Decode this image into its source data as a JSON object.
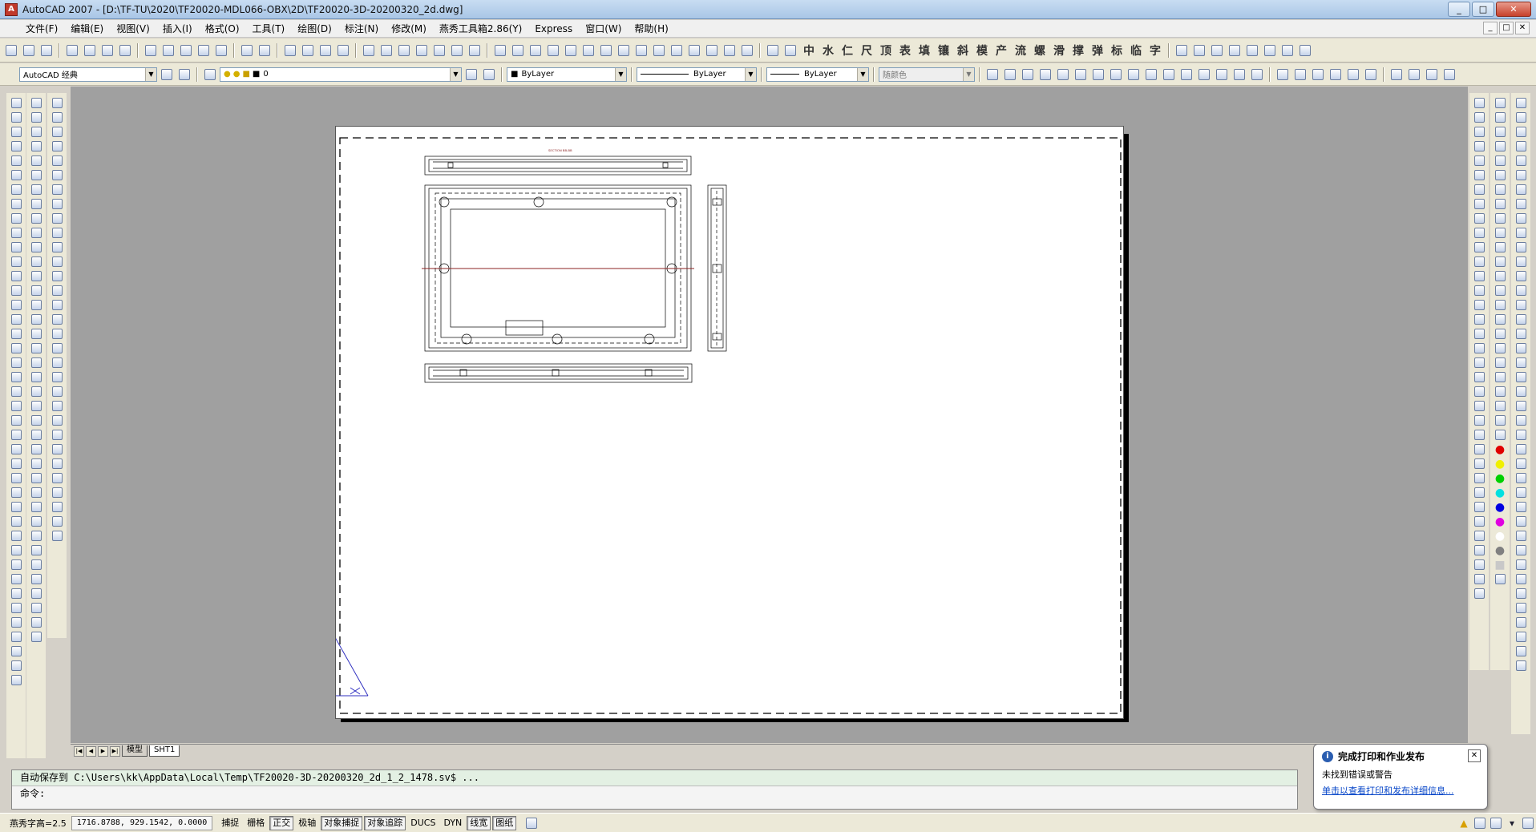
{
  "window": {
    "title": "AutoCAD 2007 - [D:\\TF-TU\\2020\\TF20020-MDL066-OBX\\2D\\TF20020-3D-20200320_2d.dwg]",
    "controls": [
      "_",
      "□",
      "✕"
    ]
  },
  "menu": [
    "文件(F)",
    "编辑(E)",
    "视图(V)",
    "插入(I)",
    "格式(O)",
    "工具(T)",
    "绘图(D)",
    "标注(N)",
    "修改(M)",
    "燕秀工具箱2.86(Y)",
    "Express",
    "窗口(W)",
    "帮助(H)"
  ],
  "toolbar_row1": {
    "cjk_tools": [
      "中",
      "水",
      "仁",
      "尺",
      "顶",
      "表",
      "填",
      "镶",
      "斜",
      "模",
      "产",
      "流",
      "螺",
      "滑",
      "撑",
      "弹",
      "标",
      "临",
      "字"
    ]
  },
  "toolbar_row2": {
    "workspace": "AutoCAD 经典",
    "layer": "0",
    "color": "ByLayer",
    "linetype": "ByLayer",
    "lineweight": "ByLayer",
    "plotstyle": "随颜色"
  },
  "drawing": {
    "section_label": "SECTION BB-BB"
  },
  "layout_tabs": {
    "model": "模型",
    "sheet": "SHT1"
  },
  "command": {
    "history": "自动保存到 C:\\Users\\kk\\AppData\\Local\\Temp\\TF20020-3D-20200320_2d_1_2_1478.sv$ ...",
    "prompt": "命令:"
  },
  "status": {
    "text_height": "燕秀字高=2.5",
    "coords": "1716.8788, 929.1542, 0.0000",
    "toggles": [
      {
        "label": "捕捉",
        "on": false
      },
      {
        "label": "栅格",
        "on": false
      },
      {
        "label": "正交",
        "on": true
      },
      {
        "label": "极轴",
        "on": false
      },
      {
        "label": "对象捕捉",
        "on": true
      },
      {
        "label": "对象追踪",
        "on": true
      },
      {
        "label": "DUCS",
        "on": false
      },
      {
        "label": "DYN",
        "on": false
      },
      {
        "label": "线宽",
        "on": true
      },
      {
        "label": "图纸",
        "on": true
      }
    ]
  },
  "balloon": {
    "title": "完成打印和作业发布",
    "line1": "未找到错误或警告",
    "link": "单击以查看打印和发布详细信息..."
  },
  "colors": {
    "workspace_bg": "#a0a0a0",
    "ucs_icon": "#3030c0",
    "section_line": "#8b2323"
  }
}
